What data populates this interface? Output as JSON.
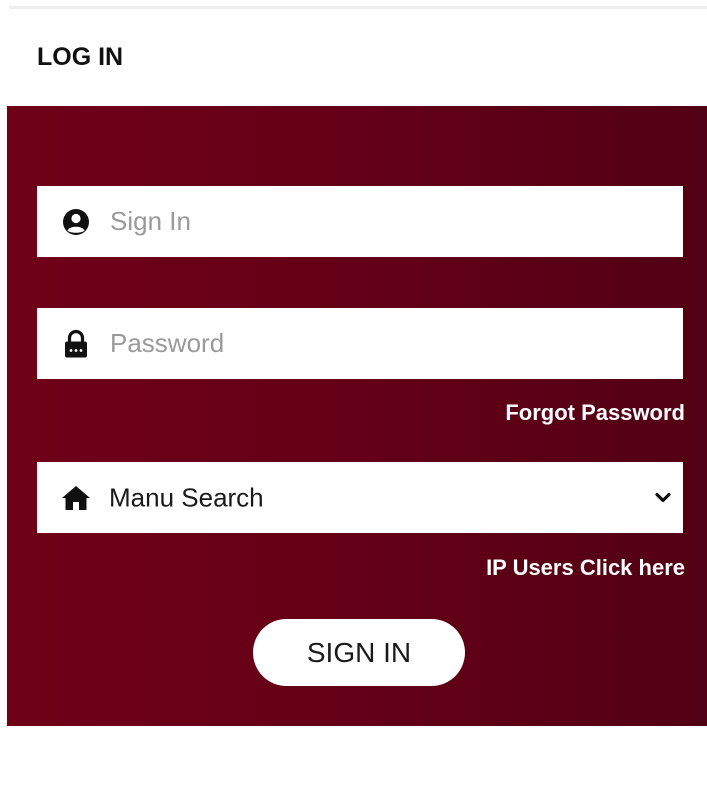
{
  "header": {
    "title": "LOG IN"
  },
  "login_form": {
    "username": {
      "value": "",
      "placeholder": "Sign In",
      "icon": "user-circle-icon"
    },
    "password": {
      "value": "",
      "placeholder": "Password",
      "icon": "lock-icon"
    },
    "forgot_password_label": "Forgot Password",
    "database_select": {
      "icon": "home-icon",
      "selected": "Manu Search",
      "dropdown_icon": "chevron-down-icon"
    },
    "ip_users_label": "IP Users Click here",
    "submit_label": "SIGN IN"
  },
  "colors": {
    "panel_start": "#6f0018",
    "panel_end": "#520015",
    "text_on_panel": "#ffffff",
    "placeholder": "#9a9a9a"
  }
}
